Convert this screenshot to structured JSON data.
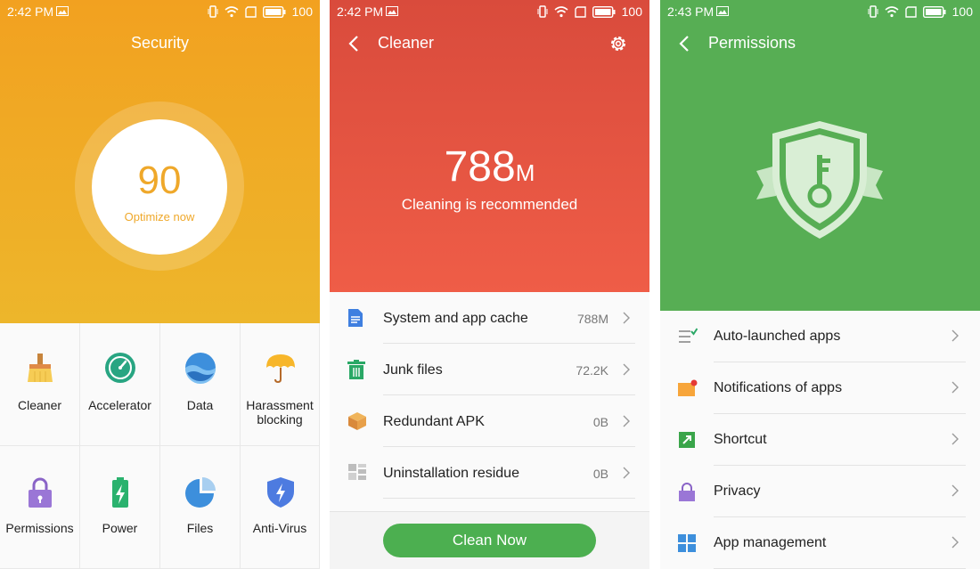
{
  "screens": {
    "security": {
      "status": {
        "time": "2:42 PM",
        "battery": "100"
      },
      "title": "Security",
      "score": "90",
      "optimize_label": "Optimize now",
      "accent": "#f2a120",
      "tiles": [
        {
          "label": "Cleaner",
          "icon": "broom-icon"
        },
        {
          "label": "Accelerator",
          "icon": "speedometer-icon"
        },
        {
          "label": "Data",
          "icon": "data-globe-icon"
        },
        {
          "label": "Harassment\nblocking",
          "icon": "umbrella-icon"
        },
        {
          "label": "Permissions",
          "icon": "lock-icon"
        },
        {
          "label": "Power",
          "icon": "battery-icon"
        },
        {
          "label": "Files",
          "icon": "pie-chart-icon"
        },
        {
          "label": "Anti-Virus",
          "icon": "shield-bolt-icon"
        }
      ]
    },
    "cleaner": {
      "status": {
        "time": "2:42 PM",
        "battery": "100"
      },
      "title": "Cleaner",
      "size_value": "788",
      "size_unit": "M",
      "recommendation": "Cleaning is recommended",
      "accent": "#e05442",
      "items": [
        {
          "label": "System and app cache",
          "value": "788M",
          "icon": "document-icon"
        },
        {
          "label": "Junk files",
          "value": "72.2K",
          "icon": "trash-icon"
        },
        {
          "label": "Redundant APK",
          "value": "0B",
          "icon": "package-icon"
        },
        {
          "label": "Uninstallation residue",
          "value": "0B",
          "icon": "residue-icon"
        }
      ],
      "clean_button": "Clean Now"
    },
    "permissions": {
      "status": {
        "time": "2:43 PM",
        "battery": "100"
      },
      "title": "Permissions",
      "accent": "#57ae54",
      "items": [
        {
          "label": "Auto-launched apps",
          "icon": "checklist-icon"
        },
        {
          "label": "Notifications of apps",
          "icon": "notification-icon"
        },
        {
          "label": "Shortcut",
          "icon": "shortcut-icon"
        },
        {
          "label": "Privacy",
          "icon": "privacy-lock-icon"
        },
        {
          "label": "App management",
          "icon": "app-grid-icon"
        }
      ]
    }
  }
}
